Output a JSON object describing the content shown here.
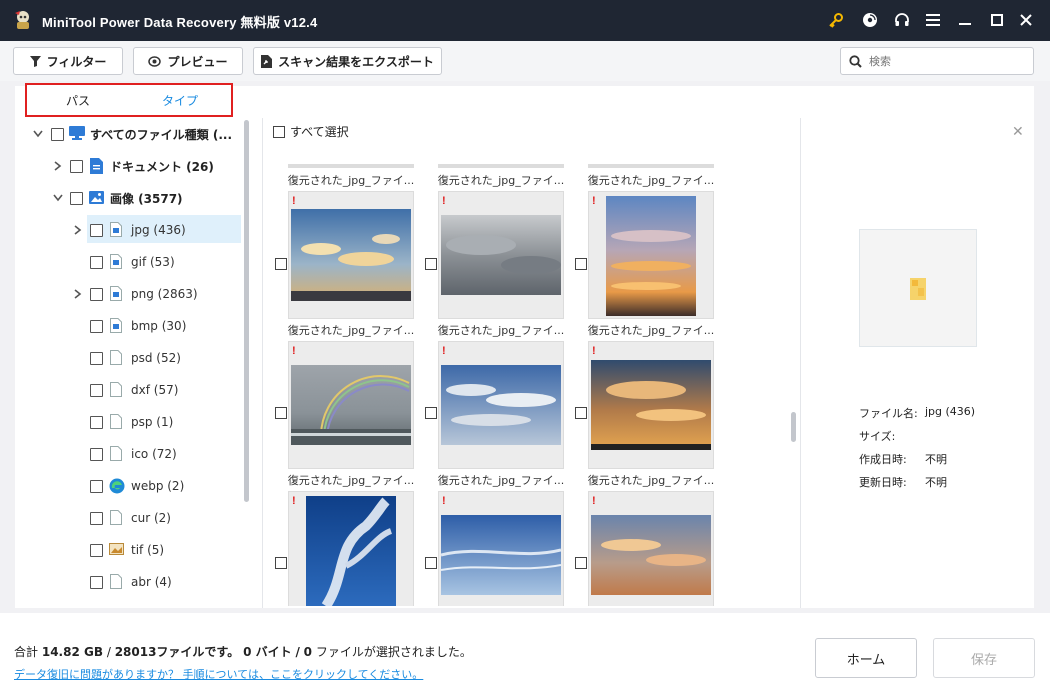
{
  "window": {
    "title": "MiniTool Power Data Recovery 無料版 v12.4"
  },
  "toolbar": {
    "filter_label": "フィルター",
    "preview_label": "プレビュー",
    "export_label": "スキャン結果をエクスポート",
    "search_placeholder": "検索"
  },
  "tabs": [
    {
      "label": "パス"
    },
    {
      "label": "タイプ"
    }
  ],
  "tree": [
    {
      "label": "すべてのファイル種類 (...",
      "bold": true,
      "icon": "monitor-icon"
    },
    {
      "label": "ドキュメント (26)",
      "bold": true,
      "icon": "document-icon"
    },
    {
      "label": "画像 (3577)",
      "bold": true,
      "icon": "image-icon"
    },
    {
      "label": "jpg (436)",
      "icon": "blue-file-icon"
    },
    {
      "label": "gif (53)",
      "icon": "blue-file-icon"
    },
    {
      "label": "png (2863)",
      "icon": "blue-file-icon"
    },
    {
      "label": "bmp (30)",
      "icon": "blue-file-icon"
    },
    {
      "label": "psd (52)",
      "icon": "blank-file-icon"
    },
    {
      "label": "dxf (57)",
      "icon": "blank-file-icon"
    },
    {
      "label": "psp (1)",
      "icon": "blank-file-icon"
    },
    {
      "label": "ico (72)",
      "icon": "blank-file-icon"
    },
    {
      "label": "webp (2)",
      "icon": "edge-icon"
    },
    {
      "label": "cur (2)",
      "icon": "blank-file-icon"
    },
    {
      "label": "tif (5)",
      "icon": "tif-file-icon"
    },
    {
      "label": "abr (4)",
      "icon": "blank-file-icon"
    }
  ],
  "grid": {
    "select_all_label": "すべて選択",
    "file_caption": "復元された_jpg_ファイ..."
  },
  "details": {
    "name_label": "ファイル名:",
    "name_value": "jpg (436)",
    "size_label": "サイズ:",
    "size_value": "",
    "created_label": "作成日時:",
    "created_value": "不明",
    "modified_label": "更新日時:",
    "modified_value": "不明"
  },
  "status": {
    "total_prefix": "合計",
    "total_size": "14.82 GB",
    "total_count": "28013ファイルです。",
    "selected_size": "0 バイト",
    "selected_sep": "/",
    "selected_count": "0",
    "selected_suffix": "ファイルが選択されました。",
    "help_link": "データ復旧に問題がありますか？ 手順については、ここをクリックしてください。"
  },
  "buttons": {
    "home": "ホーム",
    "save": "保存"
  },
  "colors": {
    "titlebar": "#1f2633",
    "accent": "#1a8be0",
    "highlight": "#e02020",
    "key": "#f5b800"
  }
}
